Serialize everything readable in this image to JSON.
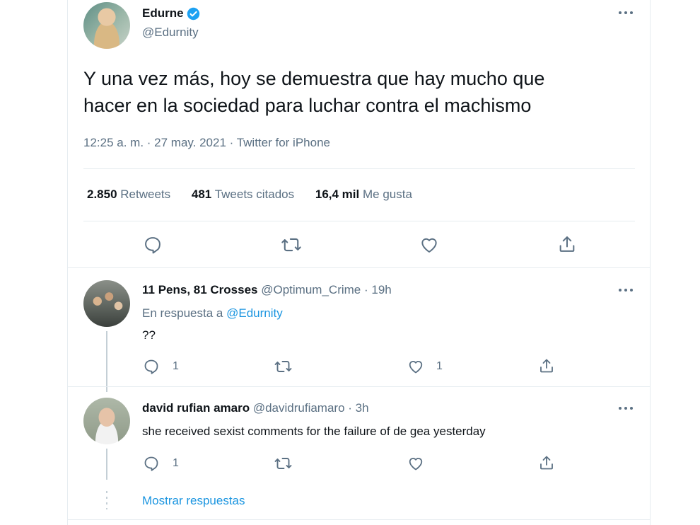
{
  "colors": {
    "accent": "#1da1f2",
    "link": "#1b95e0",
    "muted": "#5b7083",
    "border": "#e6ecf0"
  },
  "main_tweet": {
    "author_name": "Edurne",
    "handle": "@Edurnity",
    "verified": true,
    "text_line1": "Y una vez más, hoy se demuestra que hay mucho que",
    "text_line2": "hacer en la sociedad para luchar contra el machismo",
    "meta": "12:25 a. m. · 27 may. 2021 · Twitter for iPhone",
    "stats": {
      "retweets_count": "2.850",
      "retweets_label": "Retweets",
      "quotes_count": "481",
      "quotes_label": "Tweets citados",
      "likes_count": "16,4 mil",
      "likes_label": "Me gusta"
    },
    "actions": [
      "reply-icon",
      "retweet-icon",
      "like-icon",
      "share-icon"
    ]
  },
  "replies": [
    {
      "author_name": "11 Pens, 81 Crosses",
      "handle": "@Optimum_Crime",
      "time": "· 19h",
      "reply_prefix": "En respuesta a",
      "reply_to": "@Edurnity",
      "text": "??",
      "reply_count": "1",
      "like_count": "1"
    },
    {
      "author_name": "david rufian amaro",
      "handle": "@davidrufiamaro",
      "time": "· 3h",
      "text": "she received sexist comments for the failure of de gea yesterday",
      "reply_count": "1"
    }
  ],
  "show_replies_label": "Mostrar respuestas"
}
